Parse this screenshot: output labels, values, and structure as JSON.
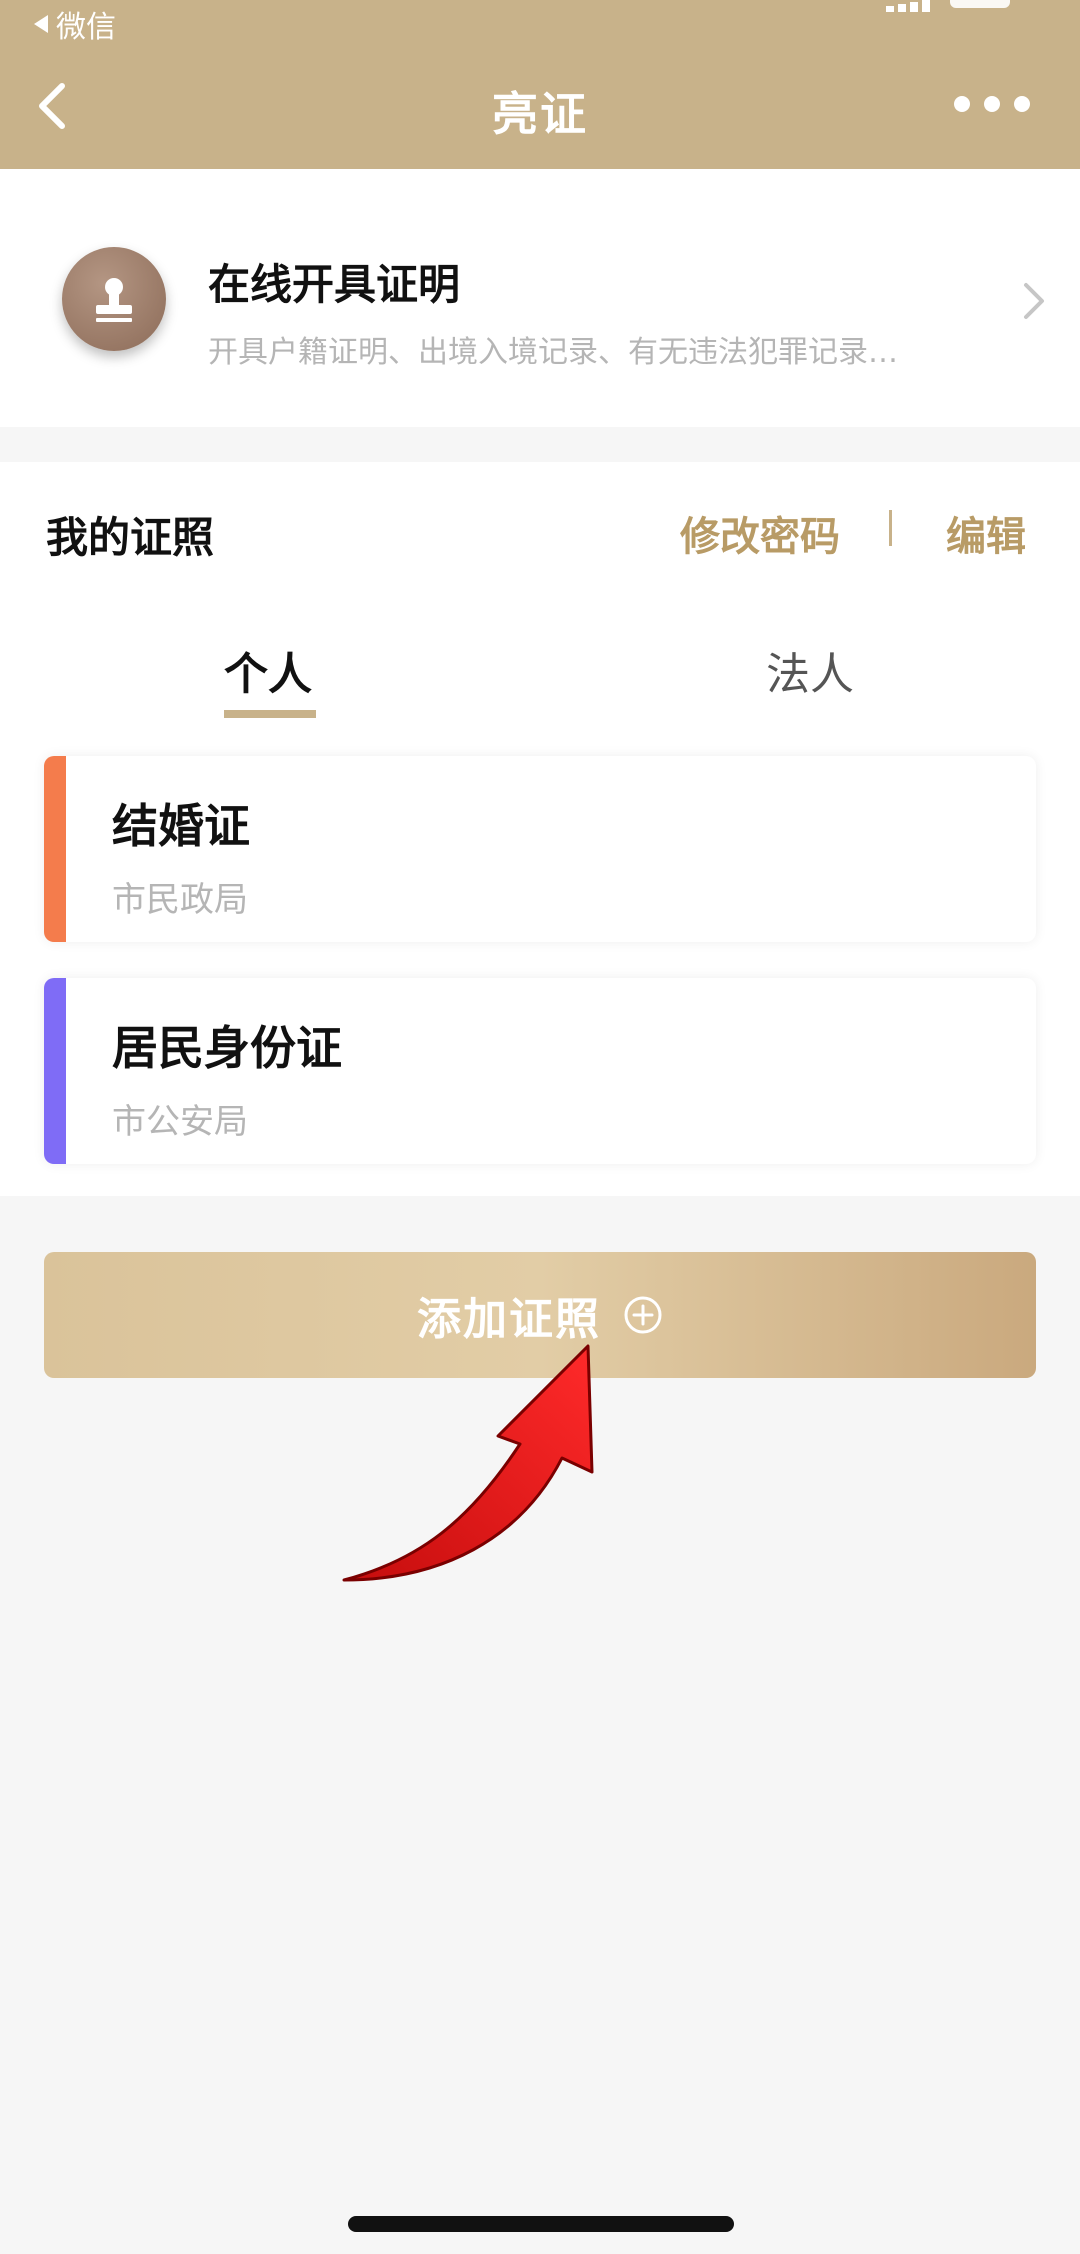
{
  "status_bar": {
    "back_app": "微信"
  },
  "nav": {
    "title": "亮证",
    "back_icon": "chevron-left-icon",
    "more_icon": "more-dots-icon"
  },
  "certificate": {
    "title": "在线开具证明",
    "subtitle": "开具户籍证明、出境入境记录、有无违法犯罪记录…",
    "icon": "stamp-icon"
  },
  "licenses": {
    "section_title": "我的证照",
    "change_password": "修改密码",
    "edit": "编辑",
    "tabs": [
      {
        "label": "个人",
        "active": true
      },
      {
        "label": "法人",
        "active": false
      }
    ],
    "items": [
      {
        "name": "结婚证",
        "issuer": "市民政局",
        "color": "#f47c4c"
      },
      {
        "name": "居民身份证",
        "issuer": "市公安局",
        "color": "#7f6cf6"
      }
    ]
  },
  "add_button": {
    "label": "添加证照",
    "icon": "plus-circle-icon"
  },
  "colors": {
    "header": "#c8b28a",
    "accent_text": "#b89b66",
    "annotation_arrow": "#e01515"
  }
}
